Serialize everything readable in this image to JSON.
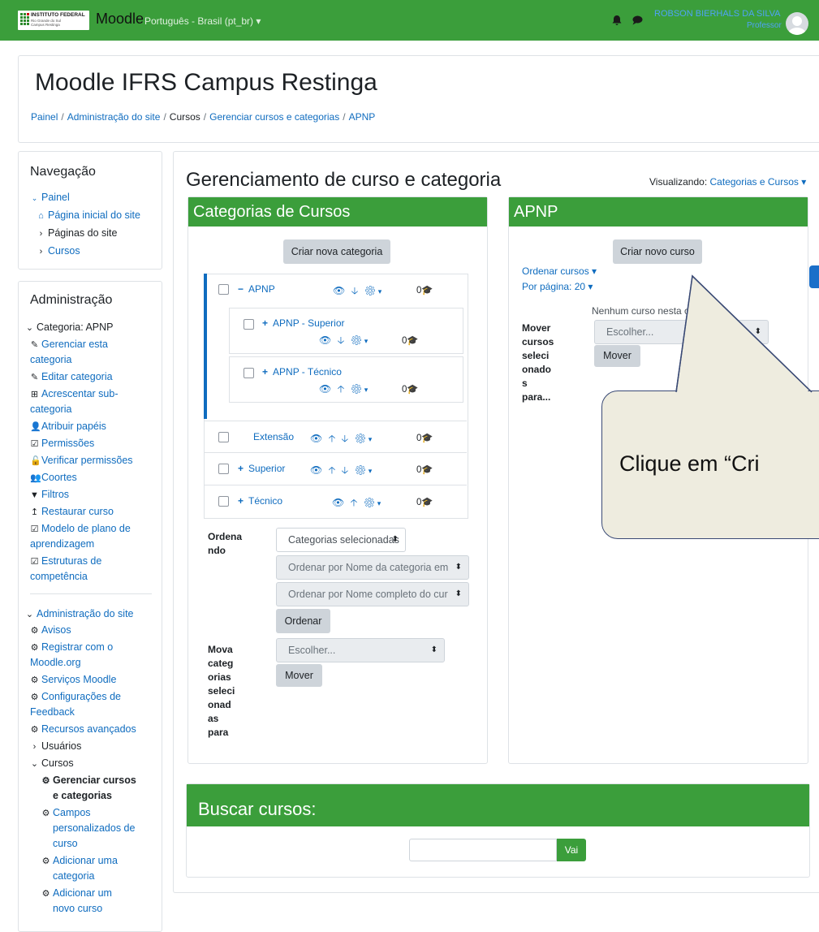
{
  "navbar": {
    "logo_line1": "INSTITUTO FEDERAL",
    "logo_line2": "Rio Grande do Sul",
    "logo_line3": "Campus Restinga",
    "brand": "Moodle",
    "language": "Português - Brasil (pt_br) ▾",
    "user_name": "ROBSON BIERHALS DA SILVA",
    "user_role": "Professor"
  },
  "header": {
    "title": "Moodle IFRS Campus Restinga",
    "breadcrumbs": [
      "Painel",
      "Administração do site",
      "Cursos",
      "Gerenciar cursos e categorias",
      "APNP"
    ]
  },
  "navigation": {
    "title": "Navegação",
    "items": [
      "Painel",
      "Página inicial do site",
      "Páginas do site",
      "Cursos"
    ]
  },
  "admin": {
    "title": "Administração",
    "category_heading": "Categoria: APNP",
    "cat_items": [
      "Gerenciar esta",
      "categoria",
      "Editar categoria",
      "Acrescentar sub-",
      "categoria",
      "Atribuir papéis",
      "Permissões",
      "Verificar permissões",
      "Coortes",
      "Filtros",
      "Restaurar curso",
      "Modelo de plano de",
      "aprendizagem",
      "Estruturas de",
      "competência"
    ],
    "site_heading": "Administração do site",
    "site_items": [
      "Avisos",
      "Registrar com o",
      "Moodle.org",
      "Serviços Moodle",
      "Configurações de",
      "Feedback",
      "Recursos avançados",
      "Usuários",
      "Cursos",
      "Gerenciar cursos",
      "e categorias",
      "Campos",
      "personalizados de",
      "curso",
      "Adicionar uma",
      "categoria",
      "Adicionar um",
      "novo curso"
    ]
  },
  "main": {
    "title": "Gerenciamento de curso e categoria",
    "viewing_label": "Visualizando:",
    "viewing_value": "Categorias e Cursos ▾"
  },
  "categories_card": {
    "title": "Categorias de Cursos",
    "create_button": "Criar nova categoria",
    "categories": [
      {
        "name": "APNP",
        "count": "0"
      },
      {
        "name": "APNP - Superior",
        "count": "0"
      },
      {
        "name": "APNP - Técnico",
        "count": "0"
      },
      {
        "name": "Extensão",
        "count": "0"
      },
      {
        "name": "Superior",
        "count": "0"
      },
      {
        "name": "Técnico",
        "count": "0"
      }
    ],
    "sort_label": [
      "Ordena",
      "ndo"
    ],
    "sort_select1": "Categorias selecionadas",
    "sort_select2": "Ordenar por Nome da categoria em",
    "sort_select3": "Ordenar por Nome completo do cur",
    "sort_button": "Ordenar",
    "move_label": [
      "Mova",
      "categ",
      "orias",
      "seleci",
      "onad",
      "as",
      "para"
    ],
    "move_select": "Escolher...",
    "move_button": "Mover"
  },
  "courses_card": {
    "title": "APNP",
    "create_button": "Criar novo curso",
    "sort_courses": "Ordenar cursos ▾",
    "per_page": "Por página: 20 ▾",
    "empty_message": "Nenhum curso nesta c",
    "move_label": [
      "Mover",
      "cursos",
      "seleci",
      "onado",
      "s",
      "para..."
    ],
    "move_select": "Escolher...",
    "move_button": "Mover"
  },
  "search": {
    "title": "Buscar cursos:",
    "button": "Vai"
  },
  "callout": {
    "text": "Clique em “Cri"
  }
}
